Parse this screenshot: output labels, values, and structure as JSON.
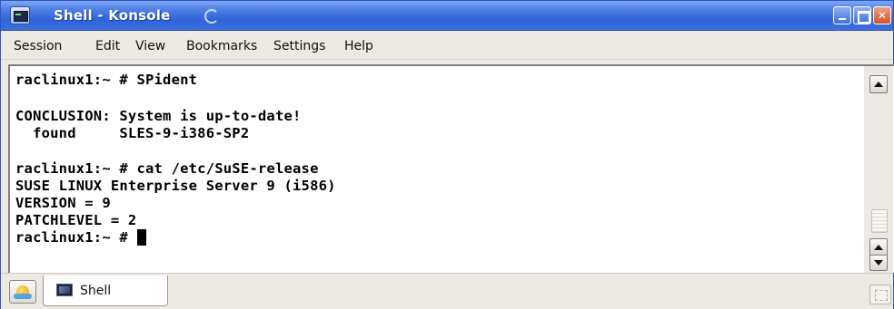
{
  "window": {
    "title": "Shell - Konsole"
  },
  "menu": {
    "items": [
      "Session",
      "Edit",
      "View",
      "Bookmarks",
      "Settings",
      "Help"
    ]
  },
  "terminal": {
    "lines": [
      "raclinux1:~ # SPident",
      "",
      "CONCLUSION: System is up-to-date!",
      "  found     SLES-9-i386-SP2",
      "",
      "raclinux1:~ # cat /etc/SuSE-release",
      "SUSE LINUX Enterprise Server 9 (i586)",
      "VERSION = 9",
      "PATCHLEVEL = 2",
      "raclinux1:~ #"
    ]
  },
  "tabs": {
    "items": [
      {
        "label": "Shell"
      }
    ]
  },
  "icons": {
    "app": "konsole-icon",
    "new_session": "new-session-icon",
    "tab": "terminal-icon"
  },
  "colors": {
    "titlebar": "#3c6fdc",
    "menubar": "#ece9e2",
    "terminal_bg": "#ffffff",
    "terminal_fg": "#000000"
  }
}
